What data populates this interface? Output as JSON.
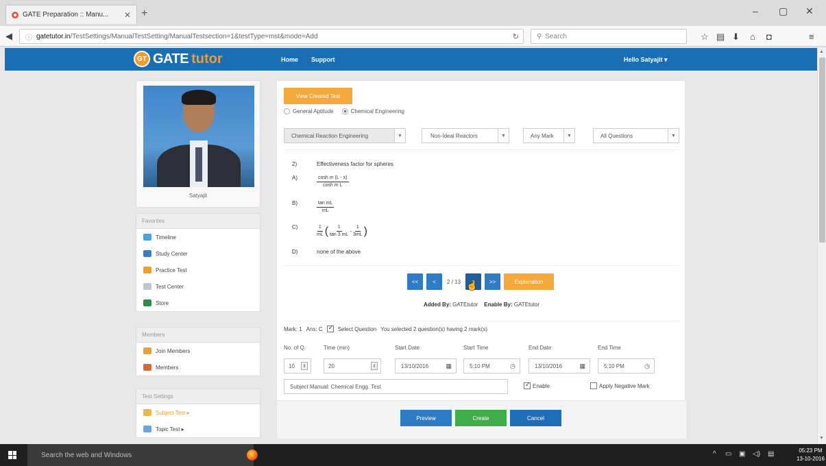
{
  "browser": {
    "tab_title": "GATE Preparation :: Manu...",
    "url_host": "gatetutor.in",
    "url_path": "/TestSettings/ManualTestSetting/ManualTestsection=1&testType=mst&mode=Add",
    "search_placeholder": "Search"
  },
  "site": {
    "logo_badge": "GT",
    "logo_word1": "GATE",
    "logo_word2": "tutor",
    "nav_home": "Home",
    "nav_support": "Support",
    "user_greeting": "Hello Satyajit ▾"
  },
  "sidebar": {
    "profile_name": "Satyajit",
    "favorites_header": "Favorites",
    "favorites": [
      "Timeline",
      "Study Center",
      "Practice Test",
      "Test Center",
      "Store"
    ],
    "members_header": "Members",
    "members": [
      "Join Members",
      "Members"
    ],
    "settings_header": "Test Settings",
    "settings": [
      "Subject Test ▸",
      "Topic Test ▸"
    ]
  },
  "main": {
    "view_created_test": "View Created Test",
    "radio_general": "General Aptitude",
    "radio_chemical": "Chemical Engineering",
    "select_subject": "Chemical Reaction Engineering",
    "select_topic": "Non-Ideal Reactors",
    "select_mark": "Any Mark",
    "select_questions": "All Questions",
    "question_number": "2)",
    "question_text": "Effectiveness factor for spheres",
    "options": {
      "a_label": "A)",
      "a_num": "cosh m (L - x)",
      "a_den": "cosh m L",
      "b_label": "B)",
      "b_num": "tan mL",
      "b_den": "mL",
      "c_label": "C)",
      "c_num": "1",
      "c_den": "mL",
      "c_inner1_num": "1",
      "c_inner1_den": "tan 3 mL",
      "c_minus": "-",
      "c_inner2_num": "1",
      "c_inner2_den": "3mL",
      "d_label": "D)",
      "d_text": "none of the above"
    },
    "pager": {
      "first": "<<",
      "prev": "<",
      "count": "2 / 13",
      "next": ">",
      "last": ">>",
      "explanation": "Explanation"
    },
    "added_by_label": "Added By:",
    "added_by_value": "GATEtutor",
    "enable_by_label": "Enable By:",
    "enable_by_value": "GATEtutor",
    "mark_label": "Mark: 1",
    "ans_label": "Ans: C",
    "select_question": "Select Question",
    "selected_summary": "You selected 2 question(s) having 2 mark(s)",
    "fields": {
      "num_q_label": "No. of Q.",
      "num_q_value": "10",
      "time_label": "Time (min)",
      "time_value": "20",
      "start_date_label": "Start Date",
      "start_date_value": "13/10/2016",
      "start_time_label": "Start Time",
      "start_time_value": "5:10 PM",
      "end_date_label": "End Date",
      "end_date_value": "13/10/2016",
      "end_time_label": "End Time",
      "end_time_value": "5:10 PM"
    },
    "test_title_value": "Subject Manual: Chemical Engg. Test",
    "enable_label": "Enable",
    "negative_label": "Apply Negative Mark",
    "preview": "Preview",
    "create": "Create",
    "cancel": "Cancel"
  },
  "taskbar": {
    "search_placeholder": "Search the web and Windows",
    "time": "05:23 PM",
    "date": "13-10-2016"
  },
  "colors": {
    "brand_blue": "#1a6fb4",
    "accent_orange": "#f5a83a",
    "preview_blue": "#2f7cc6",
    "create_green": "#3fae49",
    "cancel_blue": "#1f6fb8"
  }
}
